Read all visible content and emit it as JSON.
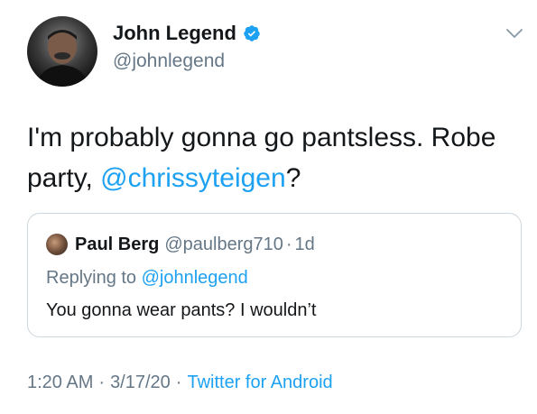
{
  "author": {
    "display_name": "John Legend",
    "handle": "@johnlegend",
    "verified_icon": "verified-badge-icon"
  },
  "tweet": {
    "text_before": "I'm probably gonna go pantsless.  Robe party, ",
    "mention": "@chrissyteigen",
    "text_after": "?"
  },
  "quoted_tweet": {
    "name": "Paul Berg",
    "handle": "@paulberg710",
    "separator": "·",
    "time": "1d",
    "replying_prefix": "Replying to ",
    "replying_to": "@johnlegend",
    "text": "You gonna wear pants? I wouldn’t"
  },
  "meta": {
    "time": "1:20 AM",
    "date": "3/17/20",
    "separator": "·",
    "source": "Twitter for Android"
  },
  "colors": {
    "accent": "#1da1f2",
    "secondary_text": "#657786",
    "border": "#ccd6dd"
  }
}
